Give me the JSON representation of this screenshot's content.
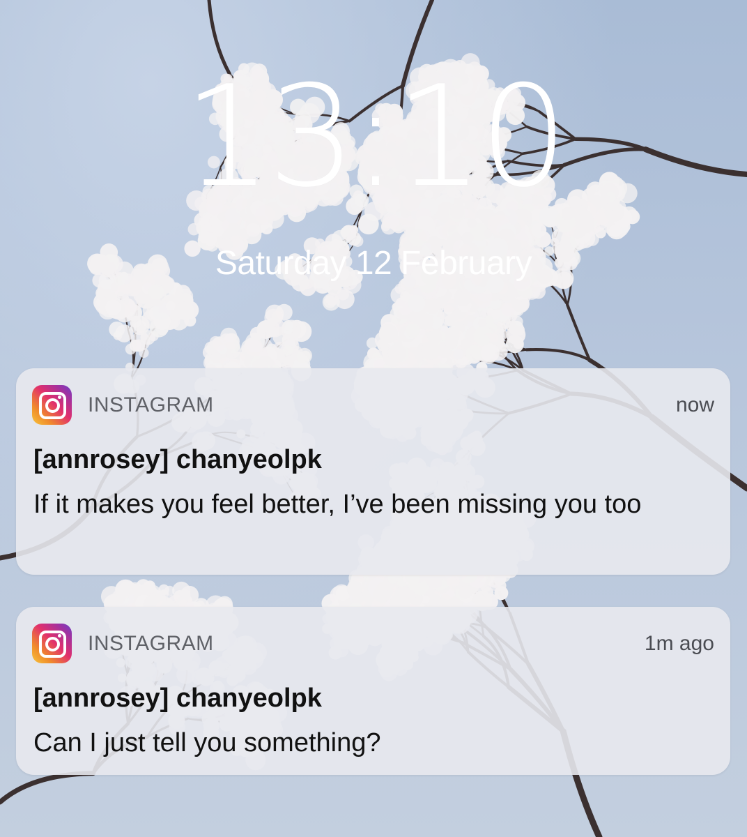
{
  "lockscreen": {
    "time": "13:10",
    "date": "Saturday 12 February"
  },
  "notifications": [
    {
      "app_icon": "instagram-icon",
      "app_name": "INSTAGRAM",
      "time": "now",
      "title": "[annrosey] chanyeolpk",
      "message": "If it makes you feel better, I’ve been missing you too"
    },
    {
      "app_icon": "instagram-icon",
      "app_name": "INSTAGRAM",
      "time": "1m ago",
      "title": "[annrosey] chanyeolpk",
      "message": "Can I just tell you something?"
    }
  ],
  "colors": {
    "sky": "#b7c6dc",
    "blossom": "#f3f1f2",
    "branch": "#3b3030",
    "notification_bg": "#e8e9ee"
  }
}
